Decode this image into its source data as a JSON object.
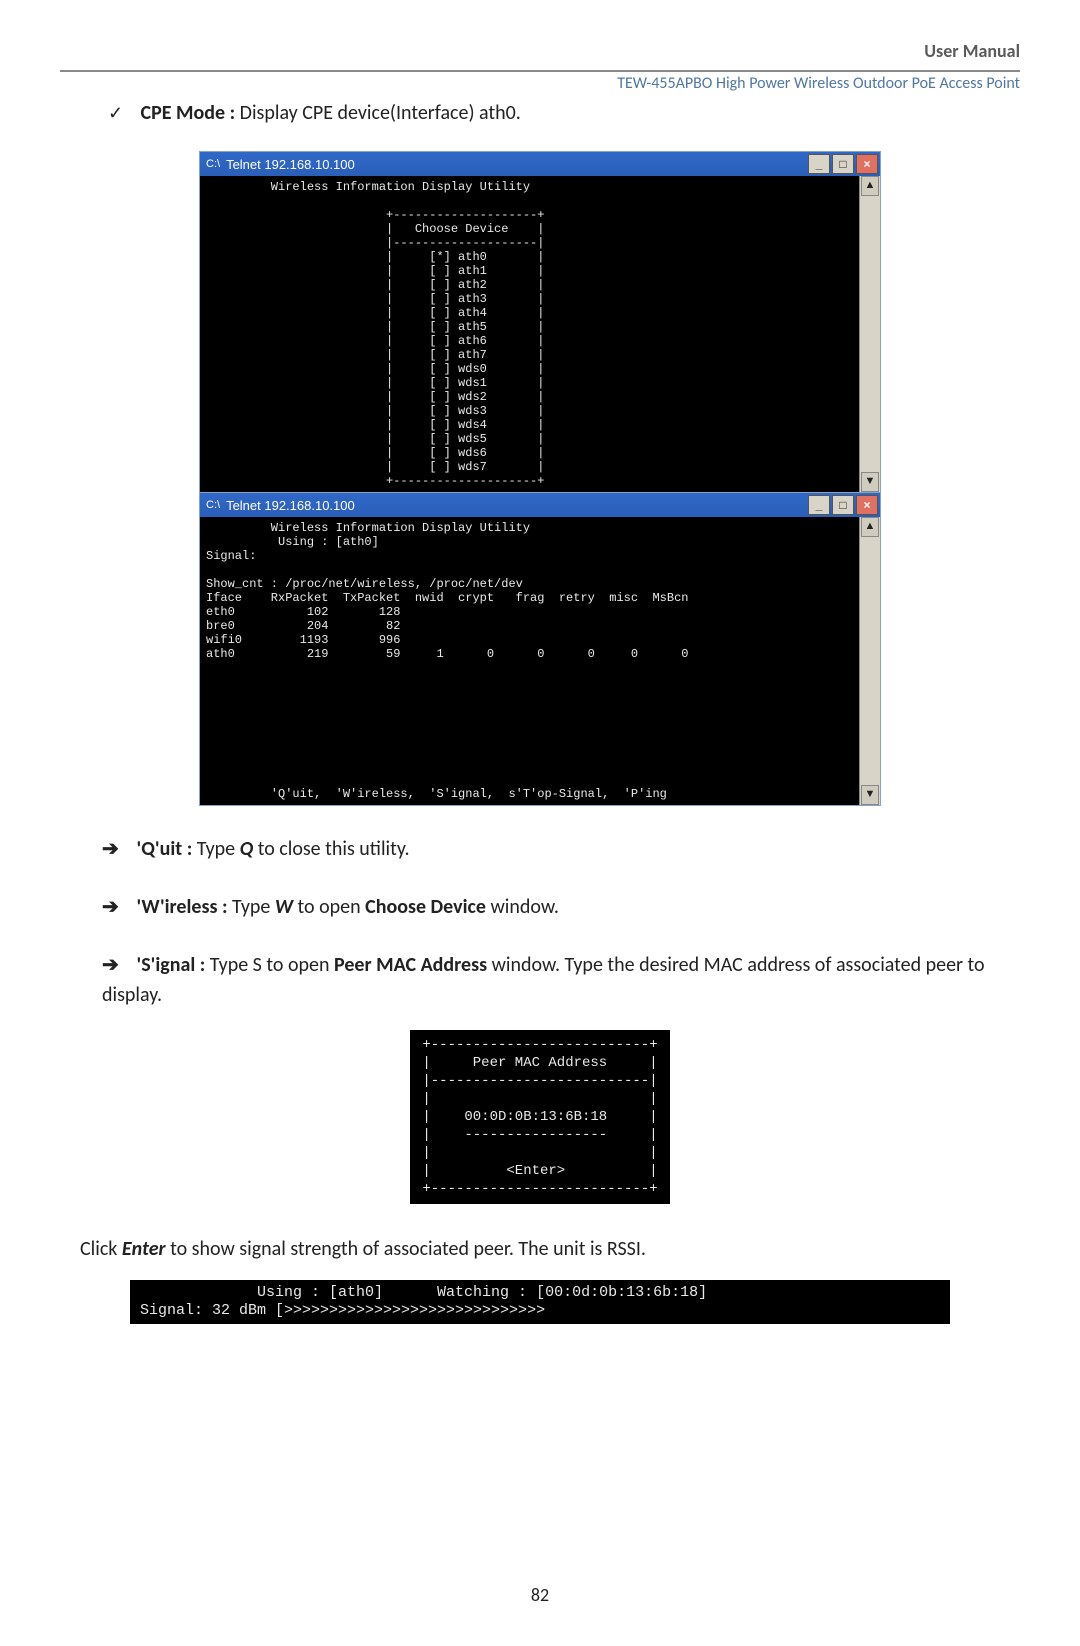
{
  "header": {
    "user_manual": "User Manual",
    "subtitle": "TEW-455APBO High Power Wireless Outdoor PoE Access Point"
  },
  "cpe": {
    "label": "CPE Mode :",
    "desc": " Display CPE device(Interface) ath0."
  },
  "telnet1": {
    "title": "Telnet 192.168.10.100",
    "util_title": "Wireless Information Display Utility",
    "choose_header": "Choose Device",
    "devices": [
      "ath0",
      "ath1",
      "ath2",
      "ath3",
      "ath4",
      "ath5",
      "ath6",
      "ath7",
      "wds0",
      "wds1",
      "wds2",
      "wds3",
      "wds4",
      "wds5",
      "wds6",
      "wds7"
    ],
    "selected_index": 0
  },
  "telnet2": {
    "title": "Telnet 192.168.10.100",
    "util_title": "Wireless Information Display Utility",
    "using": "Using : [ath0]",
    "signal_label": "Signal:",
    "show_cnt": "Show_cnt : /proc/net/wireless, /proc/net/dev",
    "columns": [
      "Iface",
      "RxPacket",
      "TxPacket",
      "nwid",
      "crypt",
      "frag",
      "retry",
      "misc",
      "MsBcn"
    ],
    "rows": [
      {
        "Iface": "eth0",
        "RxPacket": "102",
        "TxPacket": "128"
      },
      {
        "Iface": "bre0",
        "RxPacket": "204",
        "TxPacket": "82"
      },
      {
        "Iface": "wifi0",
        "RxPacket": "1193",
        "TxPacket": "996"
      },
      {
        "Iface": "ath0",
        "RxPacket": "219",
        "TxPacket": "59",
        "nwid": "1",
        "crypt": "0",
        "frag": "0",
        "retry": "0",
        "misc": "0",
        "MsBcn": "0"
      }
    ],
    "footer_hints": "'Q'uit,  'W'ireless,  'S'ignal,  s'T'op-Signal,  'P'ing"
  },
  "hints": {
    "quit_label": "'Q'uit :",
    "quit_text_a": " Type ",
    "quit_key": "Q",
    "quit_text_b": " to close this utility.",
    "wireless_label": "'W'ireless :",
    "wireless_text_a": " Type ",
    "wireless_key": "W",
    "wireless_text_b": " to open ",
    "wireless_bold": "Choose Device",
    "wireless_text_c": " window.",
    "signal_label": "'S'ignal :",
    "signal_text_a": " Type S to open ",
    "signal_bold": "Peer MAC Address",
    "signal_text_b": " window. Type the desired MAC address of associated peer to display."
  },
  "mac_box": {
    "title": "Peer MAC Address",
    "value": "00:0D:0B:13:6B:18",
    "enter": "<Enter>"
  },
  "enter_line": {
    "a": "Click ",
    "b": "Enter",
    "c": " to show signal strength of associated peer. The unit is RSSI."
  },
  "signal_strip": {
    "line1": "             Using : [ath0]      Watching : [00:0d:0b:13:6b:18]",
    "line2": "Signal: 32 dBm [>>>>>>>>>>>>>>>>>>>>>>>>>>>>>"
  },
  "page_number": "82"
}
